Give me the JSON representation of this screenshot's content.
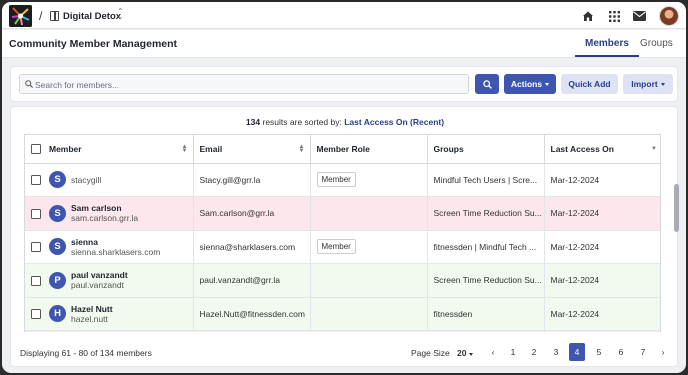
{
  "breadcrumb": {
    "separator": "/",
    "app_name": "Digital Detox"
  },
  "header": {
    "title": "Community Member Management",
    "tabs": [
      "Members",
      "Groups"
    ]
  },
  "search": {
    "placeholder": "Search for members..."
  },
  "toolbar": {
    "actions_label": "Actions",
    "quick_add_label": "Quick Add",
    "import_label": "Import"
  },
  "results": {
    "count": "134",
    "text": "results are sorted by:",
    "sort_field": "Last Access On (Recent)"
  },
  "table": {
    "columns": [
      "Member",
      "Email",
      "Member Role",
      "Groups",
      "Last Access On"
    ],
    "rows": [
      {
        "initial": "S",
        "name": "",
        "username": "stacygill",
        "email": "Stacy.gill@grr.la",
        "role": "Member",
        "groups": "Mindful Tech Users | Scre...",
        "last_access": "Mar-12-2024"
      },
      {
        "initial": "S",
        "name": "Sam carlson",
        "username": "sam.carlson.grr.la",
        "email": "Sam.carlson@grr.la",
        "role": "",
        "groups": "Screen Time Reduction Su...",
        "last_access": "Mar-12-2024"
      },
      {
        "initial": "S",
        "name": "sienna",
        "username": "sienna.sharklasers.com",
        "email": "sienna@sharklasers.com",
        "role": "Member",
        "groups": "fitnessden | Mindful Tech ...",
        "last_access": "Mar-12-2024"
      },
      {
        "initial": "P",
        "name": "paul vanzandt",
        "username": "paul.vanzandt",
        "email": "paul.vanzandt@grr.la",
        "role": "",
        "groups": "Screen Time Reduction Su...",
        "last_access": "Mar-12-2024"
      },
      {
        "initial": "H",
        "name": "Hazel Nutt",
        "username": "hazel.nutt",
        "email": "Hazel.Nutt@fitnessden.com",
        "role": "",
        "groups": "fitnessden",
        "last_access": "Mar-12-2024"
      }
    ]
  },
  "footer": {
    "displaying": "Displaying 61 - 80 of 134 members",
    "page_size_label": "Page Size",
    "page_size_value": "20",
    "pages": [
      "1",
      "2",
      "3",
      "4",
      "5",
      "6",
      "7"
    ],
    "current_page": "4"
  },
  "colors": {
    "accent": "#3e56b0",
    "pink_row": "#fce8ec",
    "green_row": "#f2faef"
  }
}
